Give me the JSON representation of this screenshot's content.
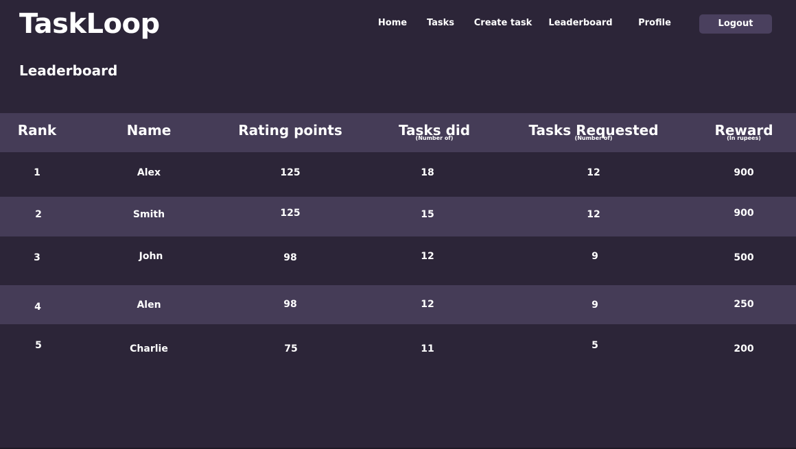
{
  "brand": "TaskLoop",
  "nav": {
    "home": "Home",
    "tasks": "Tasks",
    "create_task": "Create task",
    "leaderboard": "Leaderboard",
    "profile": "Profile",
    "logout": "Logout"
  },
  "page_title": "Leaderboard",
  "table": {
    "headers": [
      {
        "label": "Rank",
        "sub": ""
      },
      {
        "label": "Name",
        "sub": ""
      },
      {
        "label": "Rating points",
        "sub": ""
      },
      {
        "label": "Tasks did",
        "sub": "(Number of)"
      },
      {
        "label": "Tasks Requested",
        "sub": "(Number of)"
      },
      {
        "label": "Reward",
        "sub": "(In rupees)"
      }
    ],
    "rows": [
      {
        "rank": "1",
        "name": "Alex",
        "rating": "125",
        "tasks_did": "18",
        "tasks_requested": "12",
        "reward": "900"
      },
      {
        "rank": "2",
        "name": "Smith",
        "rating": "125",
        "tasks_did": "15",
        "tasks_requested": "12",
        "reward": "900"
      },
      {
        "rank": "3",
        "name": "John",
        "rating": "98",
        "tasks_did": "12",
        "tasks_requested": "9",
        "reward": "500"
      },
      {
        "rank": "4",
        "name": "Alen",
        "rating": "98",
        "tasks_did": "12",
        "tasks_requested": "9",
        "reward": "250"
      },
      {
        "rank": "5",
        "name": "Charlie",
        "rating": "75",
        "tasks_did": "11",
        "tasks_requested": "5",
        "reward": "200"
      }
    ]
  },
  "colors": {
    "background": "#2c2538",
    "row_alt": "#453c57",
    "button": "#4a405e",
    "text": "#ffffff"
  }
}
